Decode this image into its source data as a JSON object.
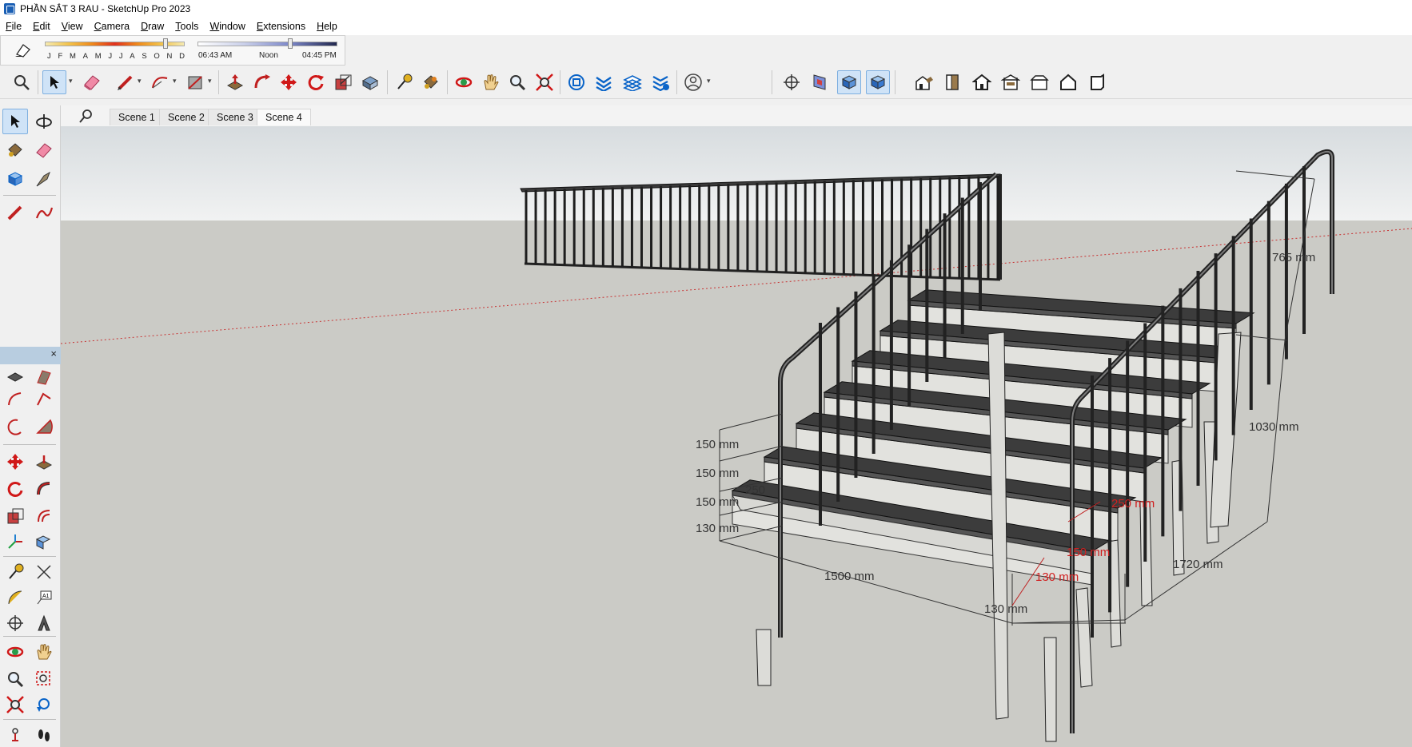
{
  "window": {
    "title": "PHẦN SẮT 3 RAU - SketchUp Pro 2023"
  },
  "menu": [
    {
      "pre": "",
      "u": "F",
      "post": "ile"
    },
    {
      "pre": "",
      "u": "E",
      "post": "dit"
    },
    {
      "pre": "",
      "u": "V",
      "post": "iew"
    },
    {
      "pre": "",
      "u": "C",
      "post": "amera"
    },
    {
      "pre": "",
      "u": "D",
      "post": "raw"
    },
    {
      "pre": "",
      "u": "T",
      "post": "ools"
    },
    {
      "pre": "",
      "u": "W",
      "post": "indow"
    },
    {
      "pre": "",
      "u": "E",
      "post": "xtensions"
    },
    {
      "pre": "",
      "u": "H",
      "post": "elp"
    }
  ],
  "shadows": {
    "months": [
      "J",
      "F",
      "M",
      "A",
      "M",
      "J",
      "J",
      "A",
      "S",
      "O",
      "N",
      "D"
    ],
    "month_slider_fraction": 0.86,
    "time_start": "06:43 AM",
    "time_noon": "Noon",
    "time_end": "04:45 PM",
    "time_slider_fraction": 0.66
  },
  "scenes": {
    "tabs": [
      "Scene 1",
      "Scene 2",
      "Scene 3",
      "Scene 4"
    ],
    "active_index": 3
  },
  "dimensions": {
    "riser_1": "150 mm",
    "riser_2": "150 mm",
    "riser_3": "150 mm",
    "riser_bottom": "130 mm",
    "tread_left": "250",
    "width": "1500 mm",
    "depth": "1720 mm",
    "height": "1030 mm",
    "rail_height": "765 mm",
    "bottom_offset": "130 mm",
    "red_1": "250 mm",
    "red_2": "150 mm",
    "red_3": "130 mm"
  },
  "icons": {
    "main_toolbar": [
      "zoom-window-icon",
      "select-icon",
      "eraser-icon",
      "pencil-icon",
      "arc-icon",
      "rectangle-icon",
      "push-pull-icon",
      "follow-me-icon",
      "move-icon",
      "rotate-icon",
      "scale-icon",
      "offset-icon",
      "tape-measure-icon",
      "paint-bucket-icon",
      "orbit-icon",
      "pan-icon",
      "zoom-icon",
      "zoom-extents-icon",
      "warehouse-icon",
      "extension-warehouse-icon",
      "layout-icon",
      "extension-manager-icon",
      "user-account-icon",
      "position-camera-icon",
      "section-plane-icon",
      "section-cut-icon",
      "section-fill-icon",
      "iso-view-icon",
      "front-view-icon",
      "top-view-icon",
      "back-view-icon",
      "left-view-icon",
      "right-view-icon",
      "bottom-view-icon"
    ],
    "colors": {
      "accent": "#0a64c8",
      "selected": "#cfe3f7",
      "axis_red": "#c83232",
      "ground": "#cbcbc6",
      "sky": "#e9ecee"
    }
  }
}
